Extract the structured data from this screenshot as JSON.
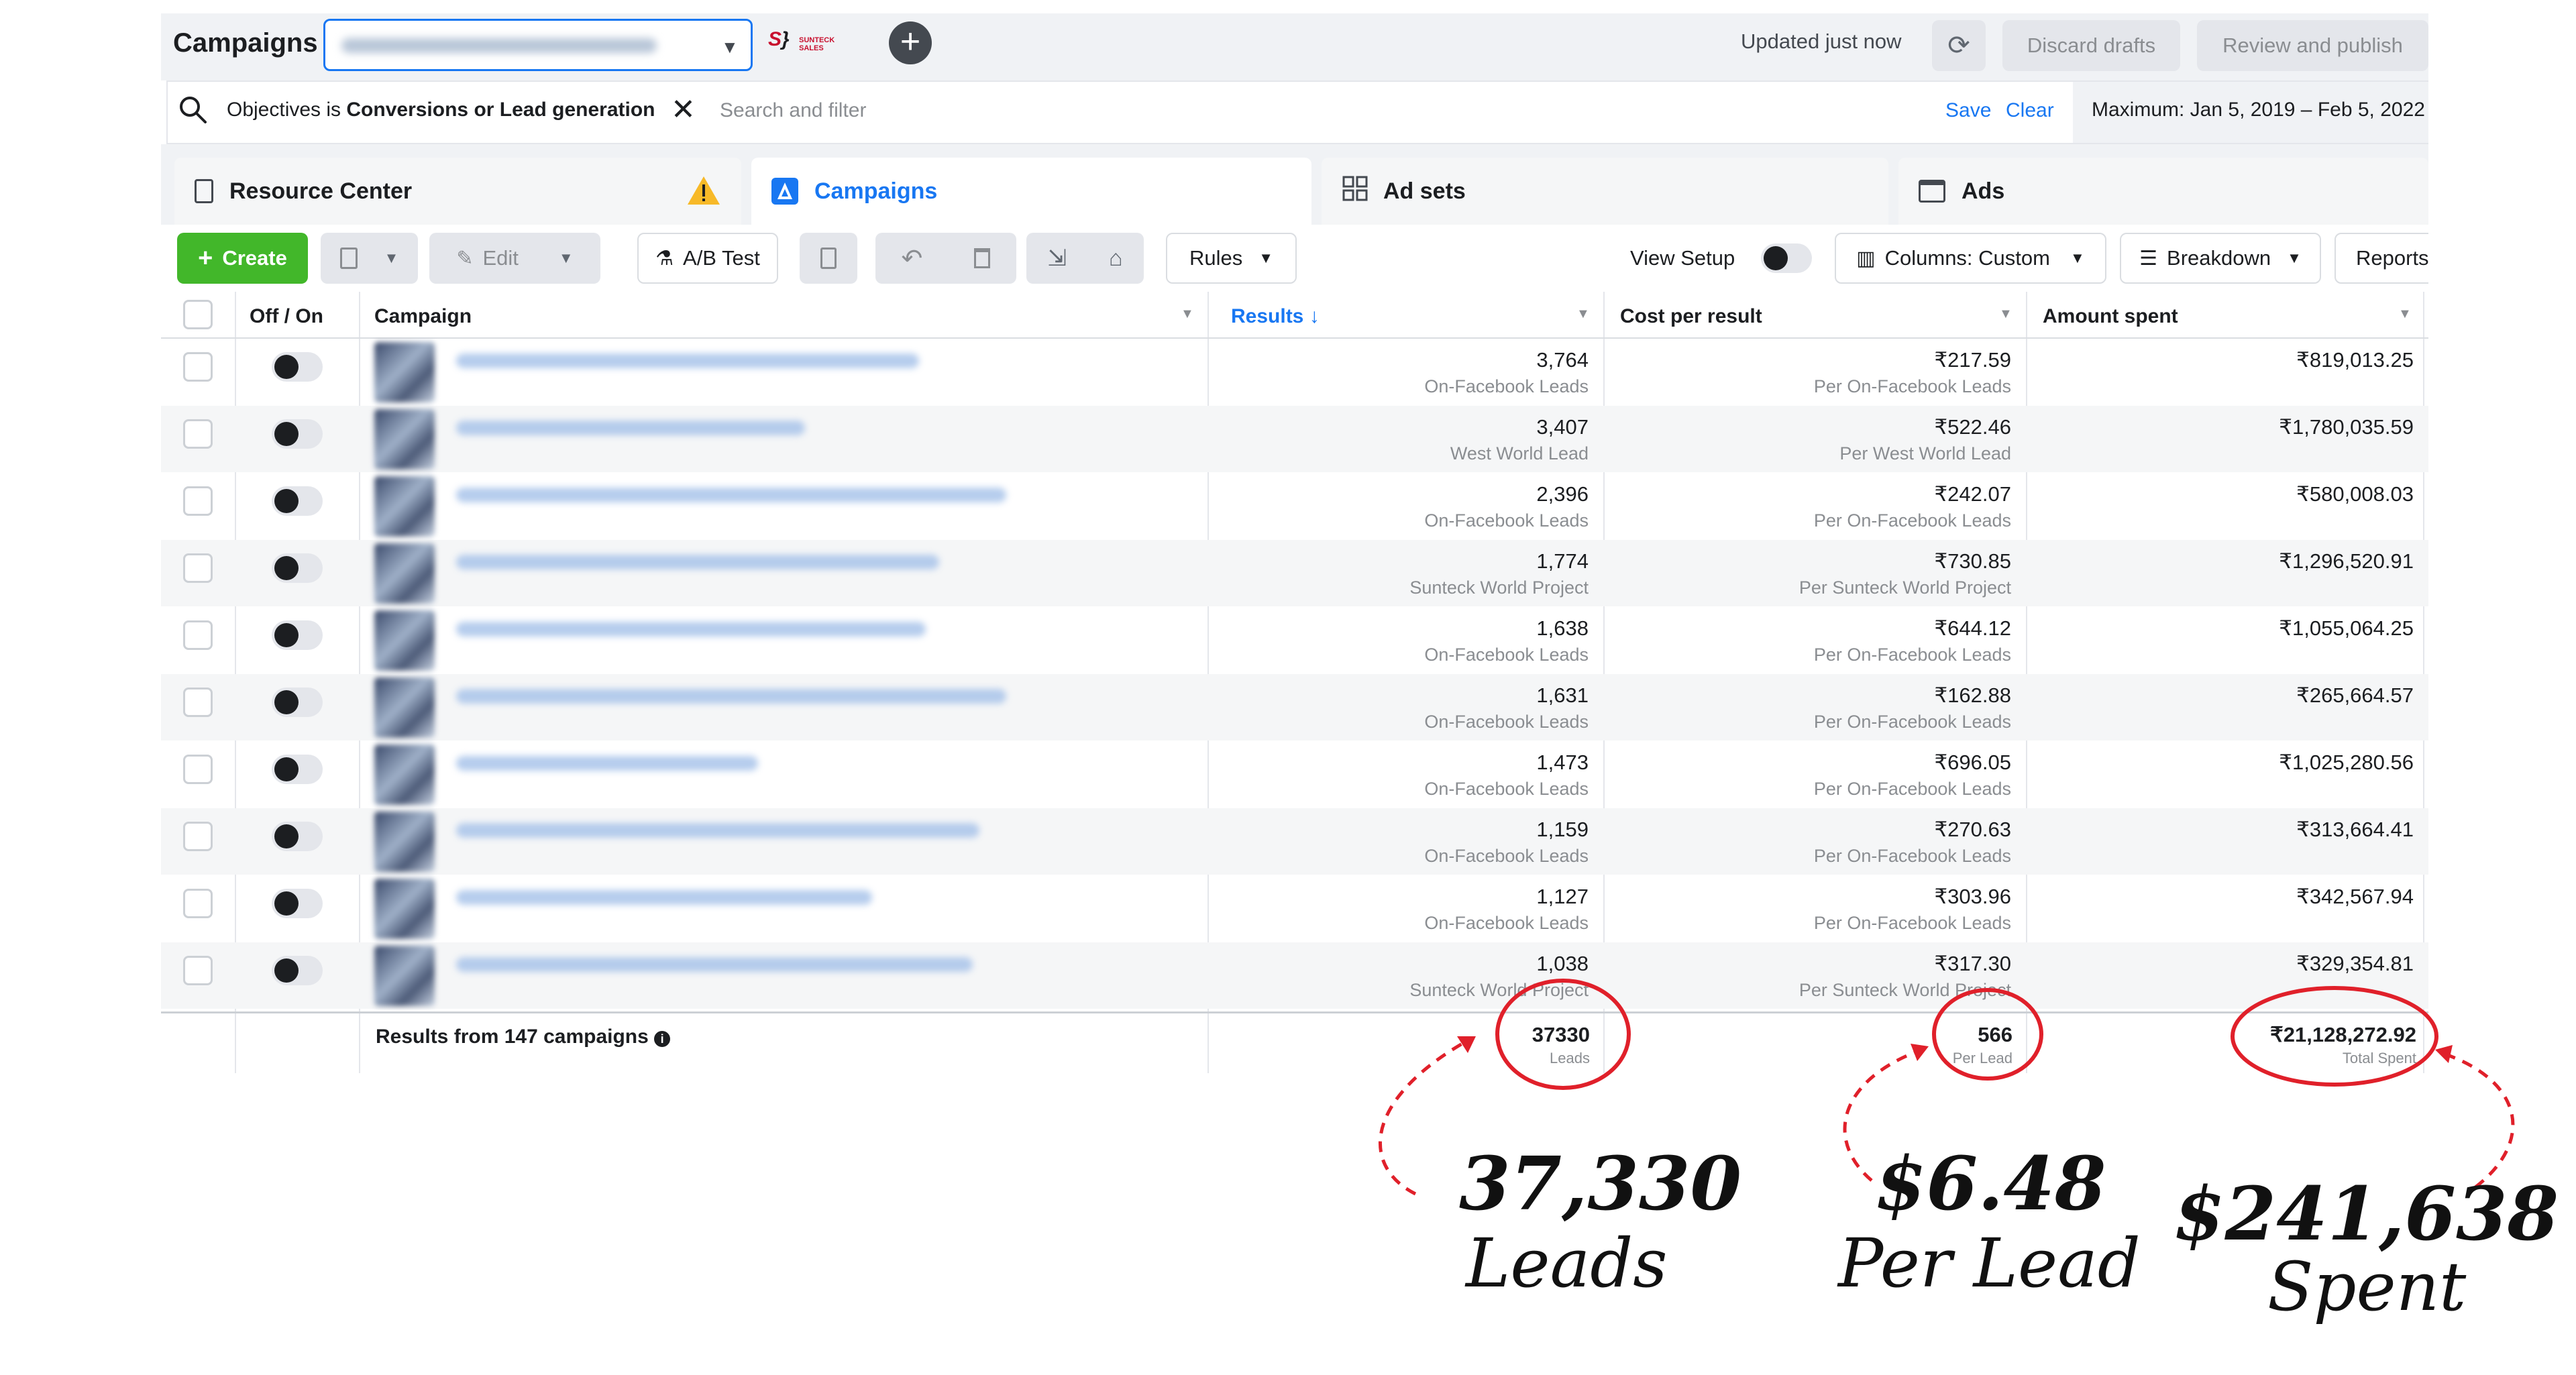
{
  "topbar": {
    "title": "Campaigns",
    "account_selector": "Sunteck Nagpore (1789456123 - blurred)",
    "logo_text": "SUNTECK SALES",
    "updated": "Updated just now",
    "discard": "Discard drafts",
    "review": "Review and publish"
  },
  "filter": {
    "chip_prefix": "Objectives is ",
    "chip_value": "Conversions or Lead generation",
    "search_placeholder": "Search and filter",
    "save": "Save",
    "clear": "Clear",
    "date_range": "Maximum: Jan 5, 2019 – Feb 5, 2022"
  },
  "tabs": {
    "resource_center": "Resource Center",
    "campaigns": "Campaigns",
    "ad_sets": "Ad sets",
    "ads": "Ads"
  },
  "toolbar": {
    "create": "Create",
    "edit": "Edit",
    "ab_test": "A/B Test",
    "rules": "Rules",
    "view_setup": "View Setup",
    "columns": "Columns: Custom",
    "breakdown": "Breakdown",
    "reports": "Reports"
  },
  "table": {
    "headers": {
      "off_on": "Off / On",
      "campaign": "Campaign",
      "results": "Results",
      "cpr": "Cost per result",
      "spent": "Amount spent"
    },
    "rows": [
      {
        "name": "West World - Sneak Peak Video - IR Lead Form April",
        "results": "3,764",
        "results_sub": "On-Facebook Leads",
        "cpr": "₹217.59",
        "cpr_sub": "Per On-Facebook Leads",
        "spent": "₹819,013.25"
      },
      {
        "name": "West World - IR Conversion Ads - April",
        "results": "3,407",
        "results_sub": "West World Lead",
        "cpr": "₹522.46",
        "cpr_sub": "Per West World Lead",
        "spent": "₹1,780,035.59"
      },
      {
        "name": "West World Sneak Peak Video - Lead Gen - OCC June Launch",
        "results": "2,396",
        "results_sub": "On-Facebook Leads",
        "cpr": "₹242.07",
        "cpr_sub": "Per On-Facebook Leads",
        "spent": "₹580,008.03"
      },
      {
        "name": "Sunteck World Launch- Conversion - Hillview - Launch",
        "results": "1,774",
        "results_sub": "Sunteck World Project",
        "cpr": "₹730.85",
        "cpr_sub": "Per Sunteck World Project",
        "spent": "₹1,296,520.91"
      },
      {
        "name": "Sunteck World Launch- 3BHK - Lead - Launch - Static",
        "results": "1,638",
        "results_sub": "On-Facebook Leads",
        "cpr": "₹644.12",
        "cpr_sub": "Per On-Facebook Leads",
        "spent": "₹1,055,064.25"
      },
      {
        "name": "Sunteck MaxxWorld Launch - Lead Gen - Video - Connectivity",
        "results": "1,631",
        "results_sub": "On-Facebook Leads",
        "cpr": "₹162.88",
        "cpr_sub": "Per On-Facebook Leads",
        "spent": "₹265,664.57"
      },
      {
        "name": "West World - IR Lead Form - April",
        "results": "1,473",
        "results_sub": "On-Facebook Leads",
        "cpr": "₹696.05",
        "cpr_sub": "Per On-Facebook Leads",
        "spent": "₹1,025,280.56"
      },
      {
        "name": "Sunteck MaxxWorld Launch - Lead Gen - Video - Amenities",
        "results": "1,159",
        "results_sub": "On-Facebook Leads",
        "cpr": "₹270.63",
        "cpr_sub": "Per On-Facebook Leads",
        "spent": "₹313,664.41"
      },
      {
        "name": "Sunteck MaxxWorld Launch - Lead Gen - Static",
        "results": "1,127",
        "results_sub": "On-Facebook Leads",
        "cpr": "₹303.96",
        "cpr_sub": "Per On-Facebook Leads",
        "spent": "₹342,567.94"
      },
      {
        "name": "Sunteck World LP Launch- Conversion - Static New Leads",
        "results": "1,038",
        "results_sub": "Sunteck World Project",
        "cpr": "₹317.30",
        "cpr_sub": "Per Sunteck World Project",
        "spent": "₹329,354.81"
      }
    ],
    "footer": {
      "label": "Results from 147 campaigns",
      "results": "37330",
      "results_sub": "Leads",
      "cpr": "566",
      "cpr_sub": "Per Lead",
      "spent": "₹21,128,272.92",
      "spent_sub": "Total Spent"
    }
  },
  "annotations": {
    "leads_num": "37,330",
    "leads_label": "Leads",
    "cpl_num": "$6.48",
    "cpl_label": "Per Lead",
    "spent_num": "$241,638",
    "spent_label": "Spent"
  },
  "colors": {
    "accent": "#1877f2",
    "create_green": "#42b72a",
    "annotation_red": "#e0202a",
    "warning": "#f7b928"
  }
}
